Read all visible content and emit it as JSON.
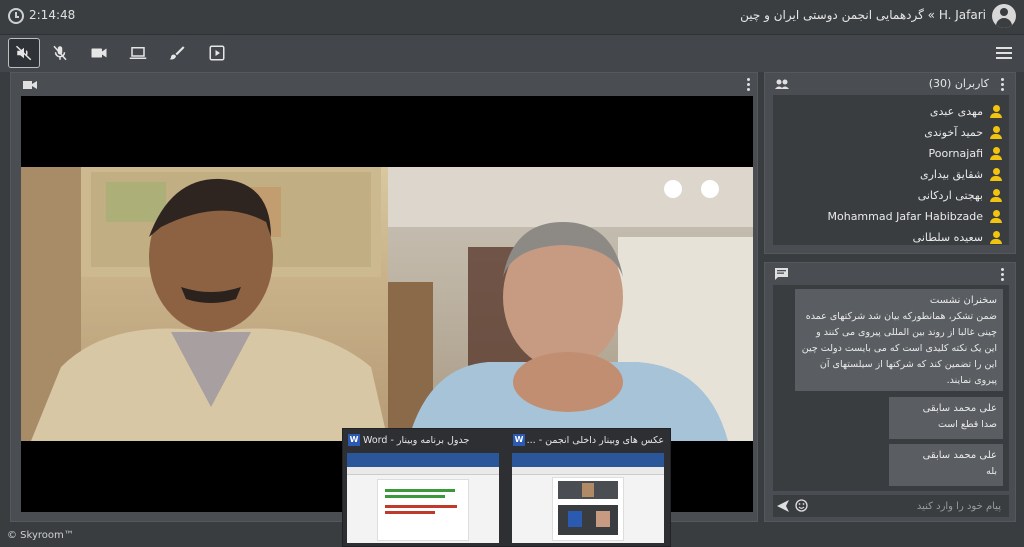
{
  "header": {
    "time": "2:14:48",
    "room_title": "H. Jafari » گردهمایی انجمن دوستی ایران و چین"
  },
  "toolbar": {
    "buttons": [
      "speaker-muted-icon",
      "mic-off-icon",
      "camera-icon",
      "screen-share-icon",
      "brush-icon",
      "presentation-icon"
    ],
    "menu_icon": "hamburger-icon"
  },
  "users": {
    "title": "کاربران (30)",
    "list": [
      "مهدی عبدی",
      "حمید آخوندی",
      "Poornajafi",
      "شقایق بیداری",
      "بهجتی اردکانی",
      "Mohammad Jafar Habibzade",
      "سعیده سلطانی"
    ]
  },
  "chat": {
    "messages": [
      {
        "sender": "سخنران نشست",
        "text": "ضمن تشکر، همانطورکه بیان شد شرکتهای عمده چینی غالبا از روند بین المللی پیروی می کنند و این یک نکته کلیدی است که می بایست دولت چین این را تضمین کند که شرکتها از سیلستهای آن پیروی نمایند."
      },
      {
        "sender": "علی محمد سابقی",
        "text": "صدا قطع است"
      },
      {
        "sender": "علی محمد سابقی",
        "text": "بله"
      }
    ],
    "input_placeholder": "پیام خود را وارد کنید"
  },
  "taskbar": {
    "windows": [
      {
        "title": "جدول برنامه وبینار - Word"
      },
      {
        "title": "عکس های وبینار داخلی انجمن - ..."
      }
    ]
  },
  "footer": {
    "brand": "© Skyroom™"
  },
  "colors": {
    "user_icon": "#f1c40f",
    "panel": "#4a4d51",
    "background": "#3a3d40",
    "word_blue": "#2b579a"
  }
}
